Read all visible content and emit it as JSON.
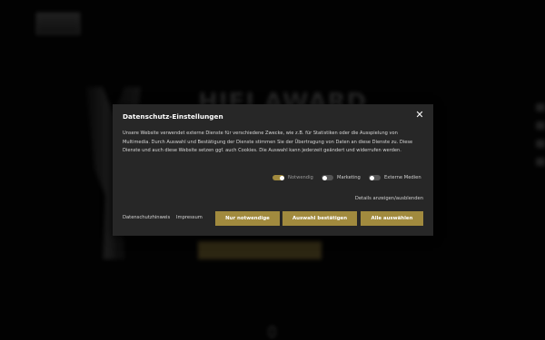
{
  "site": {
    "logo_text": "",
    "nav": [
      "",
      "",
      "",
      ""
    ],
    "hero_title": "HIFI AWARD"
  },
  "dialog": {
    "title": "Datenschutz-Einstellungen",
    "close_glyph": "✕",
    "body": "Unsere Website verwendet externe Dienste für verschiedene Zwecke, wie z.B. für Statistiken oder die Ausspielung von Multimedia. Durch Auswahl und Bestätigung der Dienste stimmen Sie der Übertragung von Daten an diese Dienste zu. Diese Dienste und auch diese Website setzen ggf. auch Cookies. Die Auswahl kann jederzeit geändert und widerrufen werden.",
    "toggles": [
      {
        "label": "Notwendig",
        "state": "on"
      },
      {
        "label": "Marketing",
        "state": "off"
      },
      {
        "label": "Externe Medien",
        "state": "off"
      }
    ],
    "details_link": "Details anzeigen/ausblenden",
    "links": {
      "privacy": "Datenschutzhinweis",
      "imprint": "Impressum"
    },
    "buttons": {
      "necessary": "Nur notwendige",
      "confirm": "Auswahl bestätigen",
      "accept_all": "Alle auswählen"
    },
    "accent_color": "#a18a3e"
  }
}
